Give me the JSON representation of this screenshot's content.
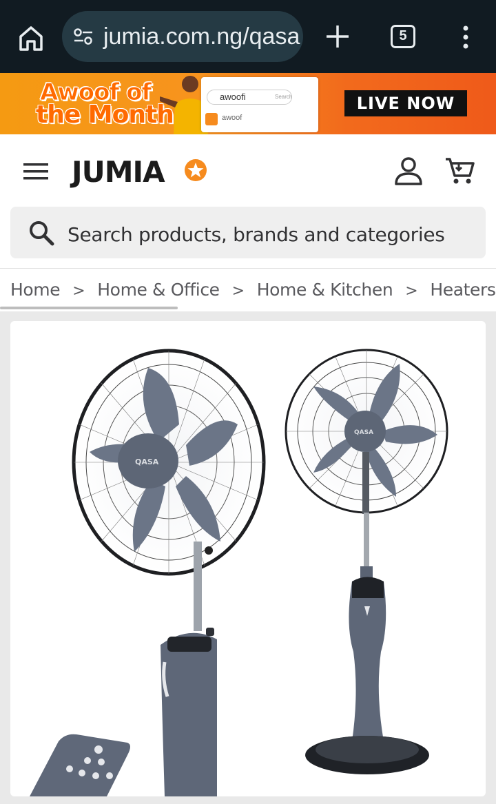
{
  "browser": {
    "url": "jumia.com.ng/qasa",
    "tab_count": "5",
    "icons": [
      "home-icon",
      "site-settings-icon",
      "new-tab-icon",
      "tab-switcher-icon",
      "more-menu-icon"
    ]
  },
  "promo": {
    "title_line1": "Awoof of",
    "title_line2": "the Month",
    "search_text": "awoofi",
    "search_button": "Search",
    "suggestion": "awoof",
    "cta": "LIVE NOW"
  },
  "header": {
    "logo": "JUMIA",
    "search_placeholder": "Search products, brands and categories",
    "brand_color": "#f68b1e"
  },
  "breadcrumb": [
    "Home",
    "Home & Office",
    "Home & Kitchen",
    "Heaters, Air C"
  ],
  "breadcrumb_separator": ">",
  "product": {
    "image_brand_text": "QASA"
  }
}
